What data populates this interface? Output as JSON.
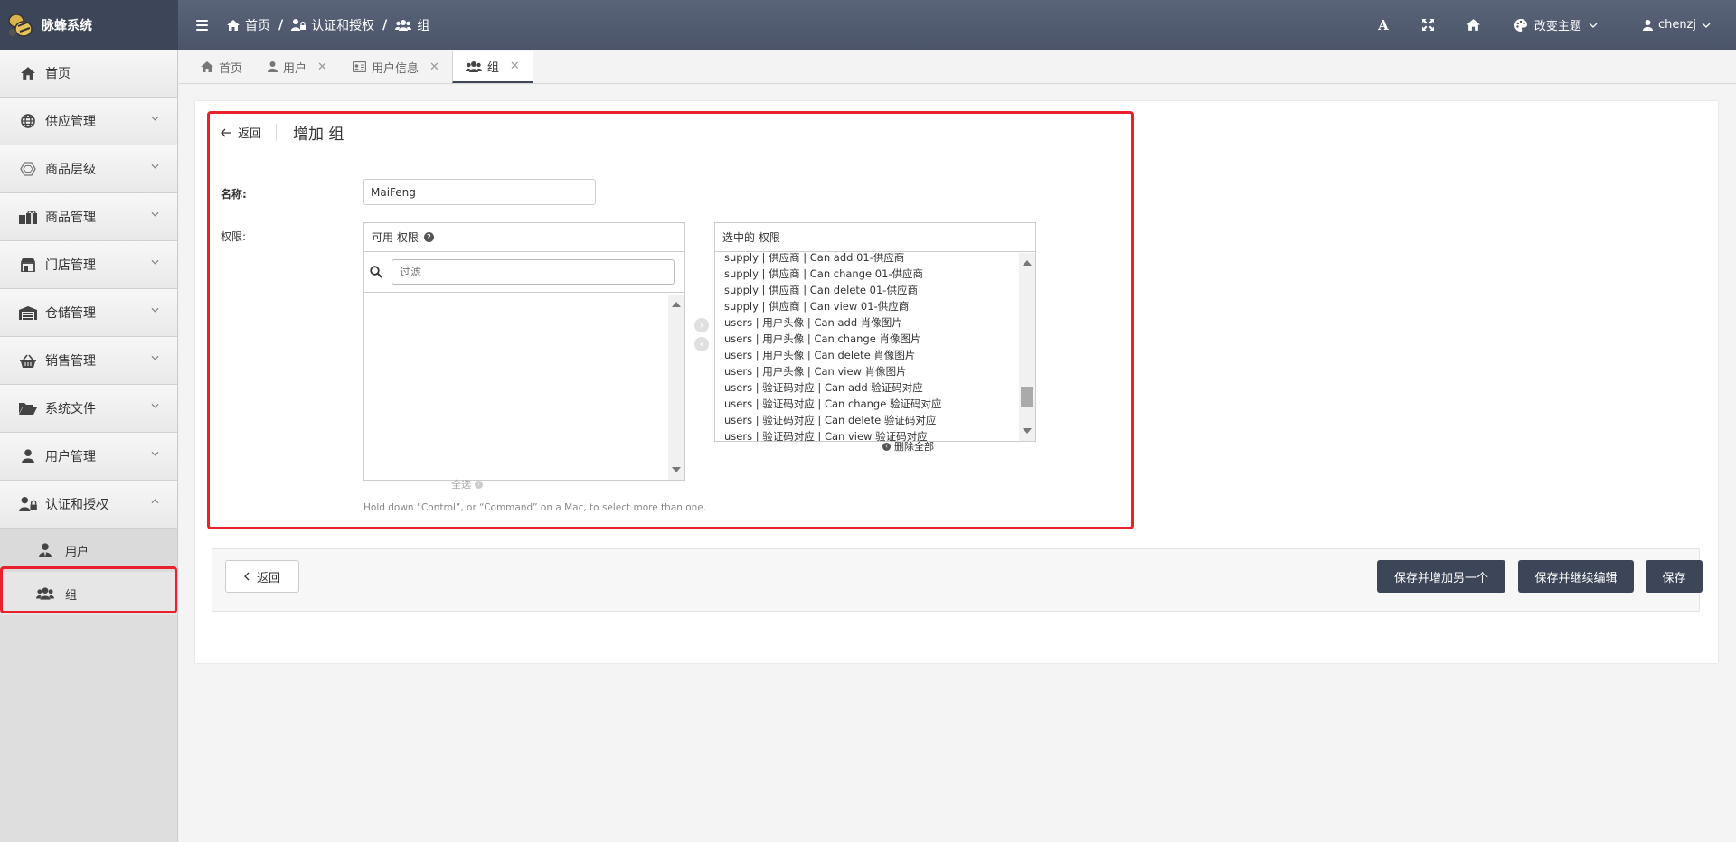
{
  "brand": {
    "name": "脉蜂系统",
    "logo": "bee-logo"
  },
  "breadcrumb": [
    {
      "label": "首页",
      "icon": "home-icon"
    },
    {
      "label": "认证和授权",
      "icon": "user-lock-icon"
    },
    {
      "label": "组",
      "icon": "users-icon"
    }
  ],
  "header": {
    "theme_label": "改变主题",
    "user_name": "chenzj",
    "font_icon": "A"
  },
  "sidebar": {
    "items": [
      {
        "label": "首页",
        "icon": "home-icon"
      },
      {
        "label": "供应管理",
        "icon": "globe-icon"
      },
      {
        "label": "商品层级",
        "icon": "hexagon-icon"
      },
      {
        "label": "商品管理",
        "icon": "gifts-icon"
      },
      {
        "label": "门店管理",
        "icon": "store-icon"
      },
      {
        "label": "仓储管理",
        "icon": "warehouse-icon"
      },
      {
        "label": "销售管理",
        "icon": "basket-icon"
      },
      {
        "label": "系统文件",
        "icon": "folder-open-icon"
      },
      {
        "label": "用户管理",
        "icon": "user-icon"
      },
      {
        "label": "认证和授权",
        "icon": "user-lock-icon"
      }
    ],
    "subitems": [
      {
        "label": "用户",
        "icon": "user-tie-icon"
      },
      {
        "label": "组",
        "icon": "users-icon"
      }
    ]
  },
  "tabs": [
    {
      "label": "首页",
      "icon": "home-icon",
      "closable": false
    },
    {
      "label": "用户",
      "icon": "user-icon",
      "closable": true
    },
    {
      "label": "用户信息",
      "icon": "id-card-icon",
      "closable": true
    },
    {
      "label": "组",
      "icon": "users-icon",
      "closable": true,
      "active": true
    }
  ],
  "form": {
    "back_label": "返回",
    "title": "增加 组",
    "name_label": "名称:",
    "name_value": "MaiFeng",
    "perm_label": "权限:",
    "available_title": "可用 权限",
    "filter_placeholder": "过滤",
    "chosen_title": "选中的 权限",
    "choose_all": "全选",
    "remove_all": "删除全部",
    "help_text": "Hold down “Control”, or “Command” on a Mac, to select more than one.",
    "chosen_options": [
      "supply | 供应商 | Can add 01-供应商",
      "supply | 供应商 | Can change 01-供应商",
      "supply | 供应商 | Can delete 01-供应商",
      "supply | 供应商 | Can view 01-供应商",
      "users | 用户头像 | Can add 肖像图片",
      "users | 用户头像 | Can change 肖像图片",
      "users | 用户头像 | Can delete 肖像图片",
      "users | 用户头像 | Can view 肖像图片",
      "users | 验证码对应 | Can add 验证码对应",
      "users | 验证码对应 | Can change 验证码对应",
      "users | 验证码对应 | Can delete 验证码对应",
      "users | 验证码对应 | Can view 验证码对应"
    ]
  },
  "actions": {
    "back": "返回",
    "save_add": "保存并增加另一个",
    "save_continue": "保存并继续编辑",
    "save": "保存"
  },
  "colors": {
    "accent": "#3d4658",
    "highlight": "#e8212b"
  }
}
